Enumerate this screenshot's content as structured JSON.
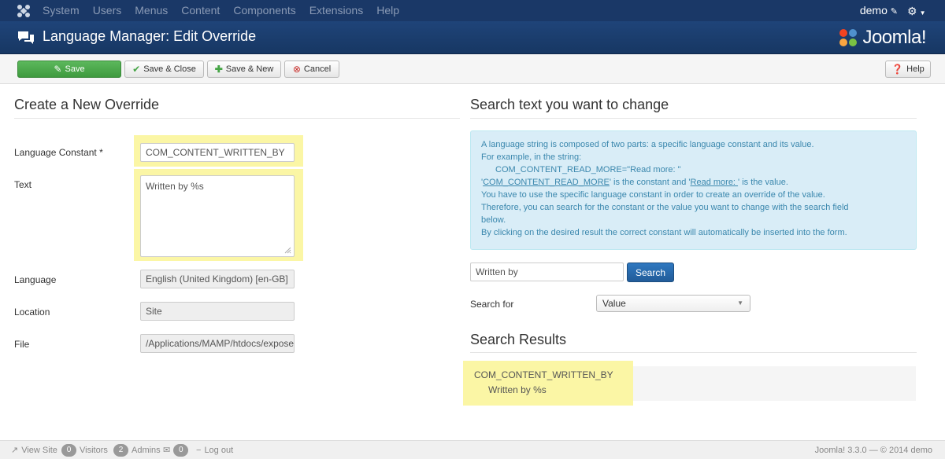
{
  "topbar": {
    "menu": [
      "System",
      "Users",
      "Menus",
      "Content",
      "Components",
      "Extensions",
      "Help"
    ],
    "user": "demo",
    "icons": {
      "logo": "joomla-logo-icon",
      "edit": "external-edit-icon",
      "settings": "gear-icon"
    }
  },
  "titlebar": {
    "title": "Language Manager: Edit Override",
    "brand": "Joomla!"
  },
  "toolbar": {
    "save": "Save",
    "save_close": "Save & Close",
    "save_new": "Save & New",
    "cancel": "Cancel",
    "help": "Help"
  },
  "left": {
    "heading": "Create a New Override",
    "fields": {
      "constant_label": "Language Constant *",
      "constant_value": "COM_CONTENT_WRITTEN_BY",
      "text_label": "Text",
      "text_value": "Written by %s",
      "language_label": "Language",
      "language_value": "English (United Kingdom) [en-GB]",
      "location_label": "Location",
      "location_value": "Site",
      "file_label": "File",
      "file_value": "/Applications/MAMP/htdocs/expose"
    }
  },
  "right": {
    "heading": "Search text you want to change",
    "info": {
      "line1": "A language string is composed of two parts: a specific language constant and its value.",
      "line2": "For example, in the string:",
      "line3": "COM_CONTENT_READ_MORE=\"Read more: \"",
      "line4_pre": "'",
      "line4_const": "COM_CONTENT_READ_MORE",
      "line4_mid": "' is the constant and '",
      "line4_val": "Read more: ",
      "line4_post": "' is the value.",
      "line5": "You have to use the specific language constant in order to create an override of the value.",
      "line6": "Therefore, you can search for the constant or the value you want to change with the search field",
      "line7": "below.",
      "line8": "By clicking on the desired result the correct constant will automatically be inserted into the form."
    },
    "search_value": "Written by",
    "search_button": "Search",
    "search_for_label": "Search for",
    "search_for_value": "Value",
    "results_heading": "Search Results",
    "result_constant": "COM_CONTENT_WRITTEN_BY",
    "result_text": "Written by %s"
  },
  "footer": {
    "view_site": "View Site",
    "visitors_count": "0",
    "visitors": "Visitors",
    "admins_count": "2",
    "admins": "Admins",
    "messages_count": "0",
    "logout": "Log out",
    "copyright": "Joomla! 3.3.0 — © 2014 demo"
  }
}
